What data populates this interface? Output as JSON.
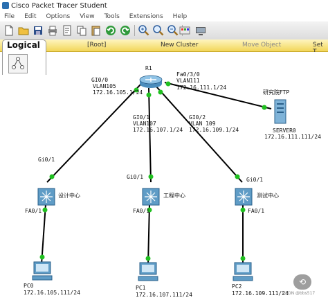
{
  "window": {
    "title": "Cisco Packet Tracer Student"
  },
  "menu": [
    "File",
    "Edit",
    "Options",
    "View",
    "Tools",
    "Extensions",
    "Help"
  ],
  "toolbar": {
    "icons": [
      "new-file-icon",
      "open-folder-icon",
      "save-icon",
      "print-icon",
      "activity-wizard-icon",
      "copy-icon",
      "paste-icon",
      "undo-icon",
      "redo-icon",
      "zoom-in-icon",
      "zoom-reset-icon",
      "zoom-out-icon",
      "palette-icon",
      "custom-device-icon"
    ]
  },
  "workspace": {
    "logical_label": "Logical",
    "root_label": "[Root]",
    "new_cluster_label": "New Cluster",
    "move_object_label": "Move Object",
    "set_tiled_label": "Set T"
  },
  "devices": {
    "router": {
      "name": "R1"
    },
    "switch1": {
      "name": "设计中心"
    },
    "switch2": {
      "name": "工程中心"
    },
    "switch3": {
      "name": "测试中心"
    },
    "server": {
      "title": "研究院FTP",
      "name": "SERVER0",
      "ip": "172.16.111.111/24"
    },
    "pc0": {
      "name": "PC0",
      "ip": "172.16.105.111/24"
    },
    "pc1": {
      "name": "PC1",
      "ip": "172.16.107.111/24"
    },
    "pc2": {
      "name": "PC2",
      "ip": "172.16.109.111/24"
    }
  },
  "labels": {
    "r_g00": {
      "port": "GI0/0",
      "vlan": "VLAN105",
      "ip": "172.16.105.1/24"
    },
    "r_fa030": {
      "port": "Fa0/3/0",
      "vlan": "VLAN111",
      "ip": "172.16.111.1/24"
    },
    "r_g01": {
      "port": "GI0/1",
      "vlan": "VLAN107",
      "ip": "172.16.107.1/24"
    },
    "r_g02": {
      "port": "GI0/2",
      "vlan": "VLAN 109",
      "ip": "172.16.109.1/24"
    },
    "s1_up": "Gi0/1",
    "s1_dn": "FA0/1",
    "s2_up": "Gi0/1",
    "s2_dn": "FA0/1",
    "s3_up": "Gi0/1",
    "s3_dn": "FA0/1"
  },
  "zoom_button": "⟲",
  "watermark": "CSDN @bbs517",
  "colors": {
    "link": "#000000",
    "link_ok": "#20c020",
    "logical_bar": "#f2d659"
  }
}
